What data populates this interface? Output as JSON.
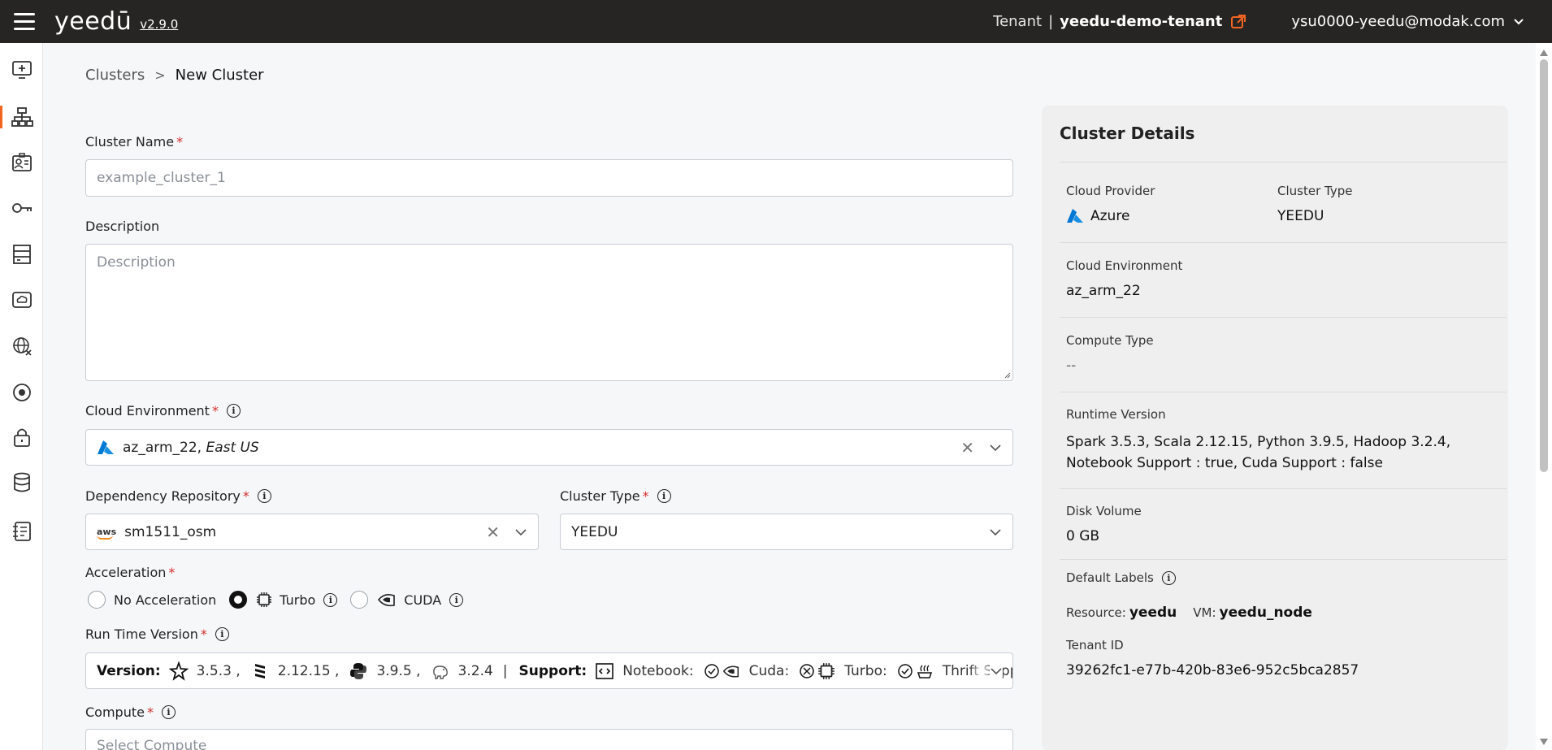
{
  "header": {
    "logo_text": "yeedū",
    "version": "v2.9.0",
    "tenant_label": "Tenant",
    "tenant_sep": "|",
    "tenant_name": "yeedu-demo-tenant",
    "user_email": "ysu0000-yeedu@modak.com"
  },
  "sidebar": {
    "items": [
      {
        "icon": "monitor-plus-icon"
      },
      {
        "icon": "sitemap-icon",
        "active": true
      },
      {
        "icon": "id-card-icon"
      },
      {
        "icon": "key-icon"
      },
      {
        "icon": "server-rack-icon"
      },
      {
        "icon": "cloud-drive-icon"
      },
      {
        "icon": "globe-network-icon"
      },
      {
        "icon": "target-icon"
      },
      {
        "icon": "lock-icon"
      },
      {
        "icon": "database-icon"
      },
      {
        "icon": "notebook-icon"
      }
    ]
  },
  "breadcrumb": {
    "parent": "Clusters",
    "separator": ">",
    "current": "New Cluster"
  },
  "form": {
    "cluster_name_label": "Cluster Name",
    "cluster_name_placeholder": "example_cluster_1",
    "description_label": "Description",
    "description_placeholder": "Description",
    "cloud_env_label": "Cloud Environment",
    "cloud_env_value": "az_arm_22,",
    "cloud_env_region": "East US",
    "dep_repo_label": "Dependency Repository",
    "dep_repo_provider": "aws",
    "dep_repo_value": "sm1511_osm",
    "cluster_type_label": "Cluster Type",
    "cluster_type_value": "YEEDU",
    "acceleration_label": "Acceleration",
    "acceleration_options": [
      {
        "label": "No Acceleration",
        "selected": false
      },
      {
        "label": "Turbo",
        "selected": true
      },
      {
        "label": "CUDA",
        "selected": false
      }
    ],
    "runtime_label": "Run Time Version",
    "runtime": {
      "version_label": "Version:",
      "spark": "3.5.3 ,",
      "scala": "2.12.15 ,",
      "python": "3.9.5 ,",
      "hadoop": "3.2.4",
      "sep": "|",
      "support_label": "Support:",
      "notebook": "Notebook:",
      "cuda": "Cuda:",
      "turbo": "Turbo:",
      "thrift": "Thrift Supp"
    },
    "compute_label": "Compute",
    "compute_placeholder": "Select Compute"
  },
  "details": {
    "title": "Cluster Details",
    "cloud_provider_label": "Cloud Provider",
    "cloud_provider_value": "Azure",
    "cluster_type_label": "Cluster Type",
    "cluster_type_value": "YEEDU",
    "cloud_env_label": "Cloud Environment",
    "cloud_env_value": "az_arm_22",
    "compute_type_label": "Compute Type",
    "compute_type_value": "--",
    "runtime_label": "Runtime Version",
    "runtime_value": "Spark 3.5.3, Scala 2.12.15, Python 3.9.5, Hadoop 3.2.4, Notebook Support : true, Cuda Support : false",
    "disk_label": "Disk Volume",
    "disk_value": "0 GB",
    "default_labels_label": "Default Labels",
    "labels": [
      {
        "key": "Resource:",
        "value": "yeedu"
      },
      {
        "key": "VM:",
        "value": "yeedu_node"
      }
    ],
    "tenant_id_label": "Tenant ID",
    "tenant_id_value": "39262fc1-e77b-420b-83e6-952c5bca2857"
  },
  "colors": {
    "topbar": "#262523",
    "accent": "#f26522",
    "required": "#d32f2f",
    "azure_blue": "#0078d4"
  }
}
